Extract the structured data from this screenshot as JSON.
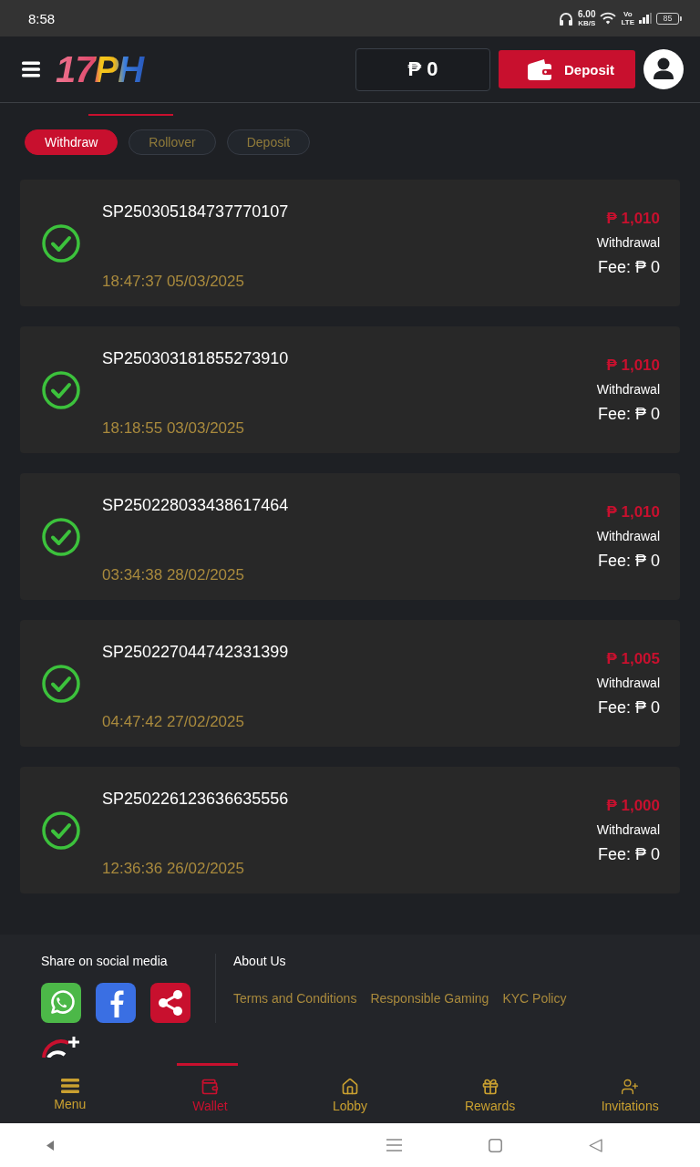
{
  "status_bar": {
    "time": "8:58",
    "speed_value": "6.00",
    "speed_unit": "KB/S",
    "volte_top": "Vo",
    "volte_bottom": "LTE",
    "battery": "85"
  },
  "header": {
    "logo": "17PH",
    "balance": "₱ 0",
    "deposit_button": "Deposit"
  },
  "tabs": [
    {
      "selected": true
    }
  ],
  "filters": [
    {
      "label": "Withdraw",
      "selected": true
    },
    {
      "label": "Rollover",
      "selected": false
    },
    {
      "label": "Deposit",
      "selected": false
    }
  ],
  "transactions": [
    {
      "id": "SP250305184737770107",
      "time": "18:47:37 05/03/2025",
      "amount": "₱ 1,010",
      "type": "Withdrawal",
      "fee": "Fee: ₱ 0",
      "completed": true
    },
    {
      "id": "SP250303181855273910",
      "time": "18:18:55 03/03/2025",
      "amount": "₱ 1,010",
      "type": "Withdrawal",
      "fee": "Fee: ₱ 0",
      "completed": true
    },
    {
      "id": "SP250228033438617464",
      "time": "03:34:38 28/02/2025",
      "amount": "₱ 1,010",
      "type": "Withdrawal",
      "fee": "Fee: ₱ 0",
      "completed": true
    },
    {
      "id": "SP250227044742331399",
      "time": "04:47:42 27/02/2025",
      "amount": "₱ 1,005",
      "type": "Withdrawal",
      "fee": "Fee: ₱ 0",
      "completed": true
    },
    {
      "id": "SP250226123636635556",
      "time": "12:36:36 26/02/2025",
      "amount": "₱ 1,000",
      "type": "Withdrawal",
      "fee": "Fee: ₱ 0",
      "completed": true
    }
  ],
  "footer": {
    "share_title": "Share on social media",
    "about_title": "About Us",
    "links": [
      "Terms and Conditions",
      "Responsible Gaming",
      "KYC Policy"
    ]
  },
  "bottom_nav": [
    {
      "label": "Menu",
      "selected": false
    },
    {
      "label": "Wallet",
      "selected": true
    },
    {
      "label": "Lobby",
      "selected": false
    },
    {
      "label": "Rewards",
      "selected": false
    },
    {
      "label": "Invitations",
      "selected": false
    }
  ]
}
